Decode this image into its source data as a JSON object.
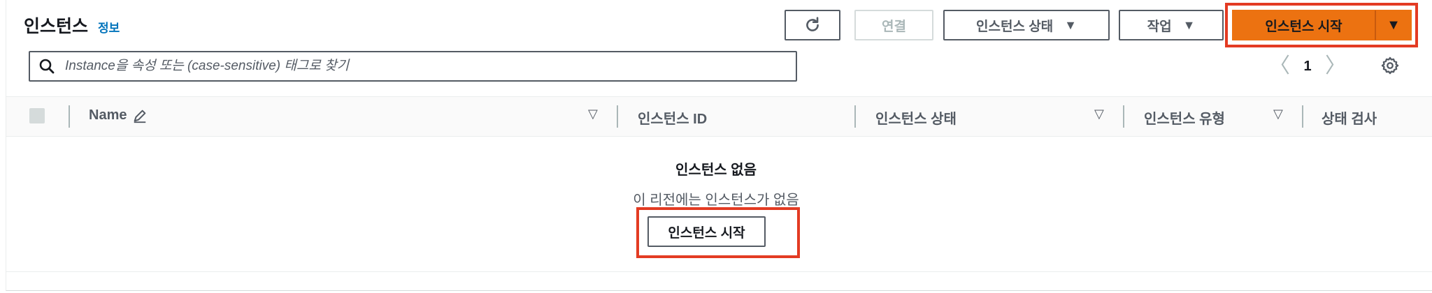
{
  "header": {
    "title": "인스턴스",
    "info_link": "정보"
  },
  "toolbar": {
    "refresh_icon": "refresh-icon",
    "connect_label": "연결",
    "instance_state_label": "인스턴스 상태",
    "actions_label": "작업",
    "launch_label": "인스턴스 시작",
    "dropdown_glyph": "▼"
  },
  "search": {
    "placeholder": "Instance을 속성 또는 (case-sensitive) 태그로 찾기",
    "value": ""
  },
  "pagination": {
    "prev": "〈",
    "page": "1",
    "next": "〉"
  },
  "table": {
    "columns": [
      {
        "label": "Name"
      },
      {
        "label": "인스턴스 ID"
      },
      {
        "label": "인스턴스 상태"
      },
      {
        "label": "인스턴스 유형"
      },
      {
        "label": "상태 검사"
      }
    ],
    "filter_glyph": "▽"
  },
  "empty_state": {
    "title": "인스턴스 없음",
    "subtitle": "이 리전에는 인스턴스가 없음",
    "button_label": "인스턴스 시작"
  },
  "colors": {
    "accent": "#ec7211",
    "highlight": "#e33b23",
    "link": "#0073bb"
  }
}
